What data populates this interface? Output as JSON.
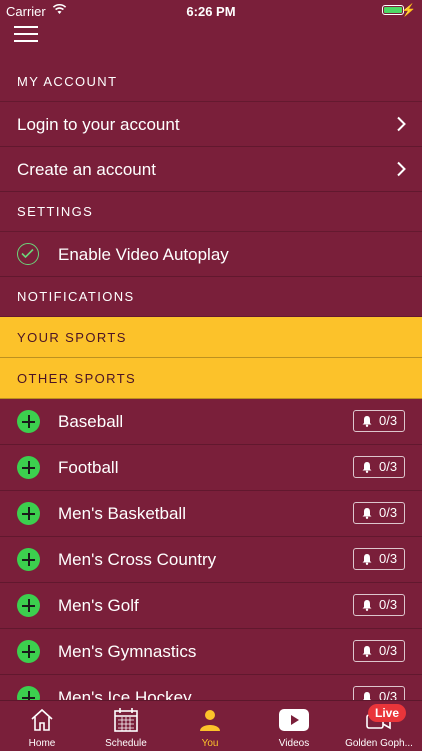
{
  "status_bar": {
    "carrier": "Carrier",
    "time": "6:26 PM"
  },
  "sections": {
    "my_account": "MY ACCOUNT",
    "settings": "SETTINGS",
    "notifications": "NOTIFICATIONS",
    "your_sports": "YOUR SPORTS",
    "other_sports": "OTHER SPORTS"
  },
  "account": {
    "login": "Login to your account",
    "create": "Create an account"
  },
  "settings": {
    "video_autoplay": "Enable Video Autoplay",
    "video_autoplay_enabled": true
  },
  "sports": [
    {
      "name": "Baseball",
      "notifications": "0/3"
    },
    {
      "name": "Football",
      "notifications": "0/3"
    },
    {
      "name": "Men's Basketball",
      "notifications": "0/3"
    },
    {
      "name": "Men's Cross Country",
      "notifications": "0/3"
    },
    {
      "name": "Men's Golf",
      "notifications": "0/3"
    },
    {
      "name": "Men's Gymnastics",
      "notifications": "0/3"
    },
    {
      "name": "Men's Ice Hockey",
      "notifications": "0/3"
    }
  ],
  "tabbar": {
    "home": "Home",
    "schedule": "Schedule",
    "you": "You",
    "videos": "Videos",
    "golden": "Golden Goph...",
    "live_badge": "Live",
    "active": "you"
  },
  "colors": {
    "background": "#7a1f3a",
    "accent_yellow": "#fcc22a",
    "plus_green": "#3ccf4e",
    "live_red": "#e9353a"
  }
}
